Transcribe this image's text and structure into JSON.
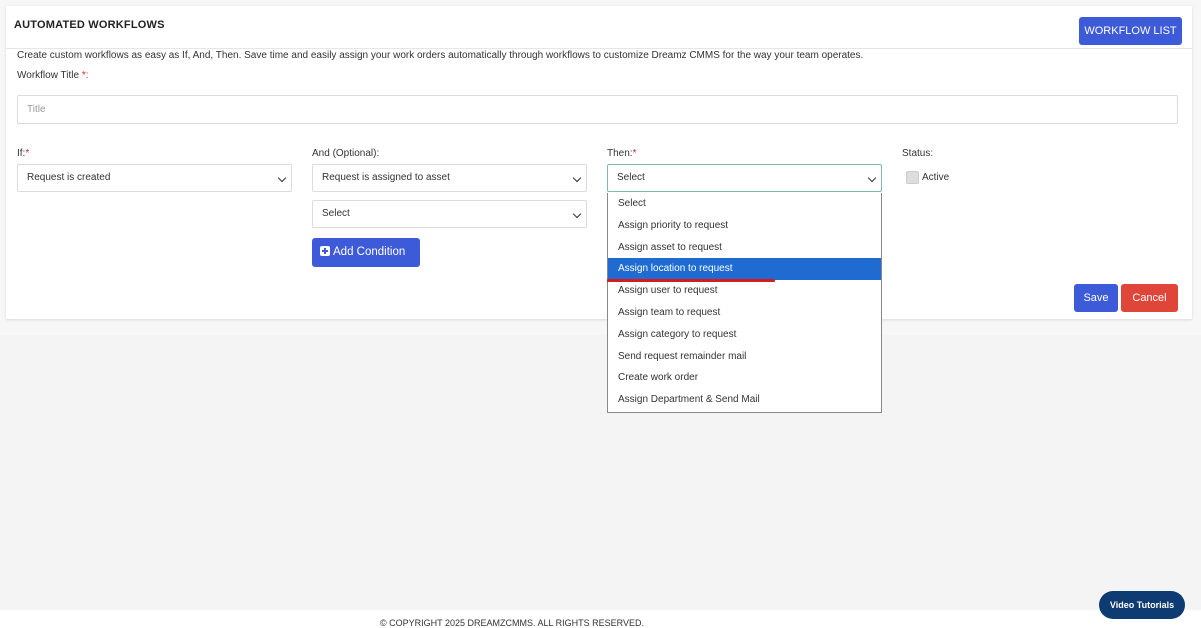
{
  "header": {
    "title": "AUTOMATED WORKFLOWS",
    "workflow_list_label": "WORKFLOW LIST"
  },
  "description": "Create custom workflows as easy as If, And, Then. Save time and easily assign your work orders automatically through workflows to customize Dreamz CMMS for the way your team operates.",
  "workflow_title": {
    "label": "Workflow Title",
    "required_mark": "*:",
    "placeholder": "Title"
  },
  "if": {
    "label": "If:",
    "required_mark": "*",
    "value": "Request is created"
  },
  "and": {
    "label": "And (Optional):",
    "value": "Request is assigned to asset",
    "second_value": "Select",
    "add_condition_label": "Add Condition"
  },
  "then": {
    "label": "Then:",
    "required_mark": "*",
    "value": "Select",
    "options": [
      "Select",
      "Assign priority to request",
      "Assign asset to request",
      "Assign location to request",
      "Assign user to request",
      "Assign team to request",
      "Assign category to request",
      "Send request remainder mail",
      "Create work order",
      "Assign Department & Send Mail"
    ],
    "highlighted_option": "Assign location to request"
  },
  "status": {
    "label": "Status:",
    "active_label": "Active"
  },
  "actions": {
    "save_label": "Save",
    "cancel_label": "Cancel"
  },
  "footer": {
    "copyright": "© COPYRIGHT 2025 DREAMZCMMS. ALL RIGHTS RESERVED.",
    "video_tutorials_label": "Video Tutorials"
  },
  "colors": {
    "primary": "#3d5bd9",
    "danger": "#e0453a",
    "highlight": "#1f6bd1",
    "navy": "#0d3b72"
  }
}
